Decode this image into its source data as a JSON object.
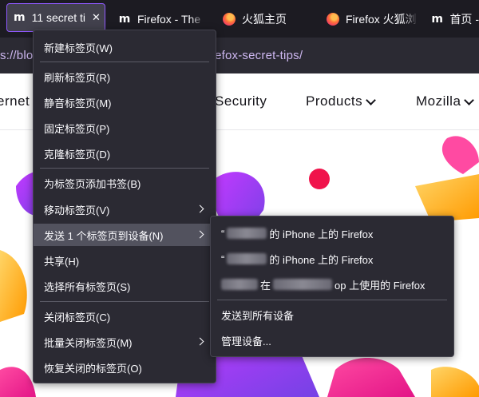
{
  "tabs": [
    {
      "title": "11 secret ti",
      "favicon": "mdn-m-icon",
      "active": true
    },
    {
      "title": "Firefox - The",
      "favicon": "mdn-m-icon"
    },
    {
      "title": "火狐主页",
      "favicon": "firefox-icon"
    },
    {
      "title": "Firefox 火狐浏",
      "favicon": "firefox-icon"
    },
    {
      "title": "首页 -",
      "favicon": "mdn-m-icon"
    }
  ],
  "url": "s://blog.mozilla.org/firefox/firefox-tips/firefox-secret-tips/",
  "nav": {
    "item1": "ernet",
    "item2": "Security",
    "item3": "Products",
    "item4": "Mozilla"
  },
  "menu": {
    "new_tab": "新建标签页(W)",
    "reload": "刷新标签页(R)",
    "mute": "静音标签页(M)",
    "pin": "固定标签页(P)",
    "duplicate": "克隆标签页(D)",
    "bookmark": "为标签页添加书签(B)",
    "move": "移动标签页(V)",
    "send": "发送 1 个标签页到设备(N)",
    "share": "共享(H)",
    "select_all": "选择所有标签页(S)",
    "close": "关闭标签页(C)",
    "close_multiple": "批量关闭标签页(M)",
    "reopen": "恢复关闭的标签页(O)"
  },
  "submenu": {
    "device1_prefix": "“",
    "device1_suffix": "的 iPhone 上的 Firefox",
    "device2_prefix": "“",
    "device2_suffix": "的 iPhone 上的 Firefox",
    "device3_mid": "在",
    "device3_suffix": "op 上使用的 Firefox",
    "send_all": "发送到所有设备",
    "manage": "管理设备..."
  },
  "colors": {
    "accent": "#9059ff",
    "menu_bg": "#2b2a33",
    "tabstrip_bg": "#1c1b22"
  }
}
